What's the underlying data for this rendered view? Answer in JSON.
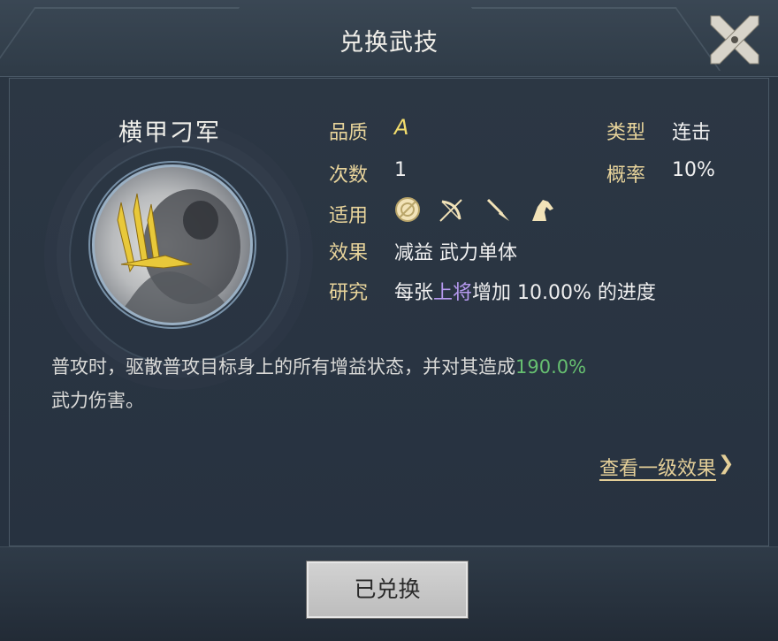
{
  "header": {
    "title": "兑换武技"
  },
  "skill": {
    "name": "横甲刁军",
    "attributes": {
      "quality": {
        "label": "品质",
        "value": "A"
      },
      "count": {
        "label": "次数",
        "value": "1"
      },
      "applicable": {
        "label": "适用",
        "icons": [
          "shield-icon",
          "bow-icon",
          "spear-icon",
          "horse-icon"
        ]
      },
      "effect": {
        "label": "效果",
        "value": "减益 武力单体"
      },
      "research": {
        "label": "研究",
        "prefix": "每张",
        "highlight": "上将",
        "suffix": "增加 10.00% 的进度"
      },
      "type": {
        "label": "类型",
        "value": "连击"
      },
      "chance": {
        "label": "概率",
        "value": "10%"
      }
    },
    "description": {
      "text": "普攻时，驱散普攻目标身上的所有增益状态，并对其造成",
      "damage": "190.0%",
      "suffix": "武力伤害。"
    },
    "view_level1_link": "查看一级效果",
    "view_level1_chevron": "❯"
  },
  "footer": {
    "button_label": "已兑换"
  },
  "colors": {
    "label_gold": "#e8d49b",
    "quality_yellow": "#f3dd6d",
    "research_purple": "#b79af0",
    "damage_green": "#66bf70"
  }
}
